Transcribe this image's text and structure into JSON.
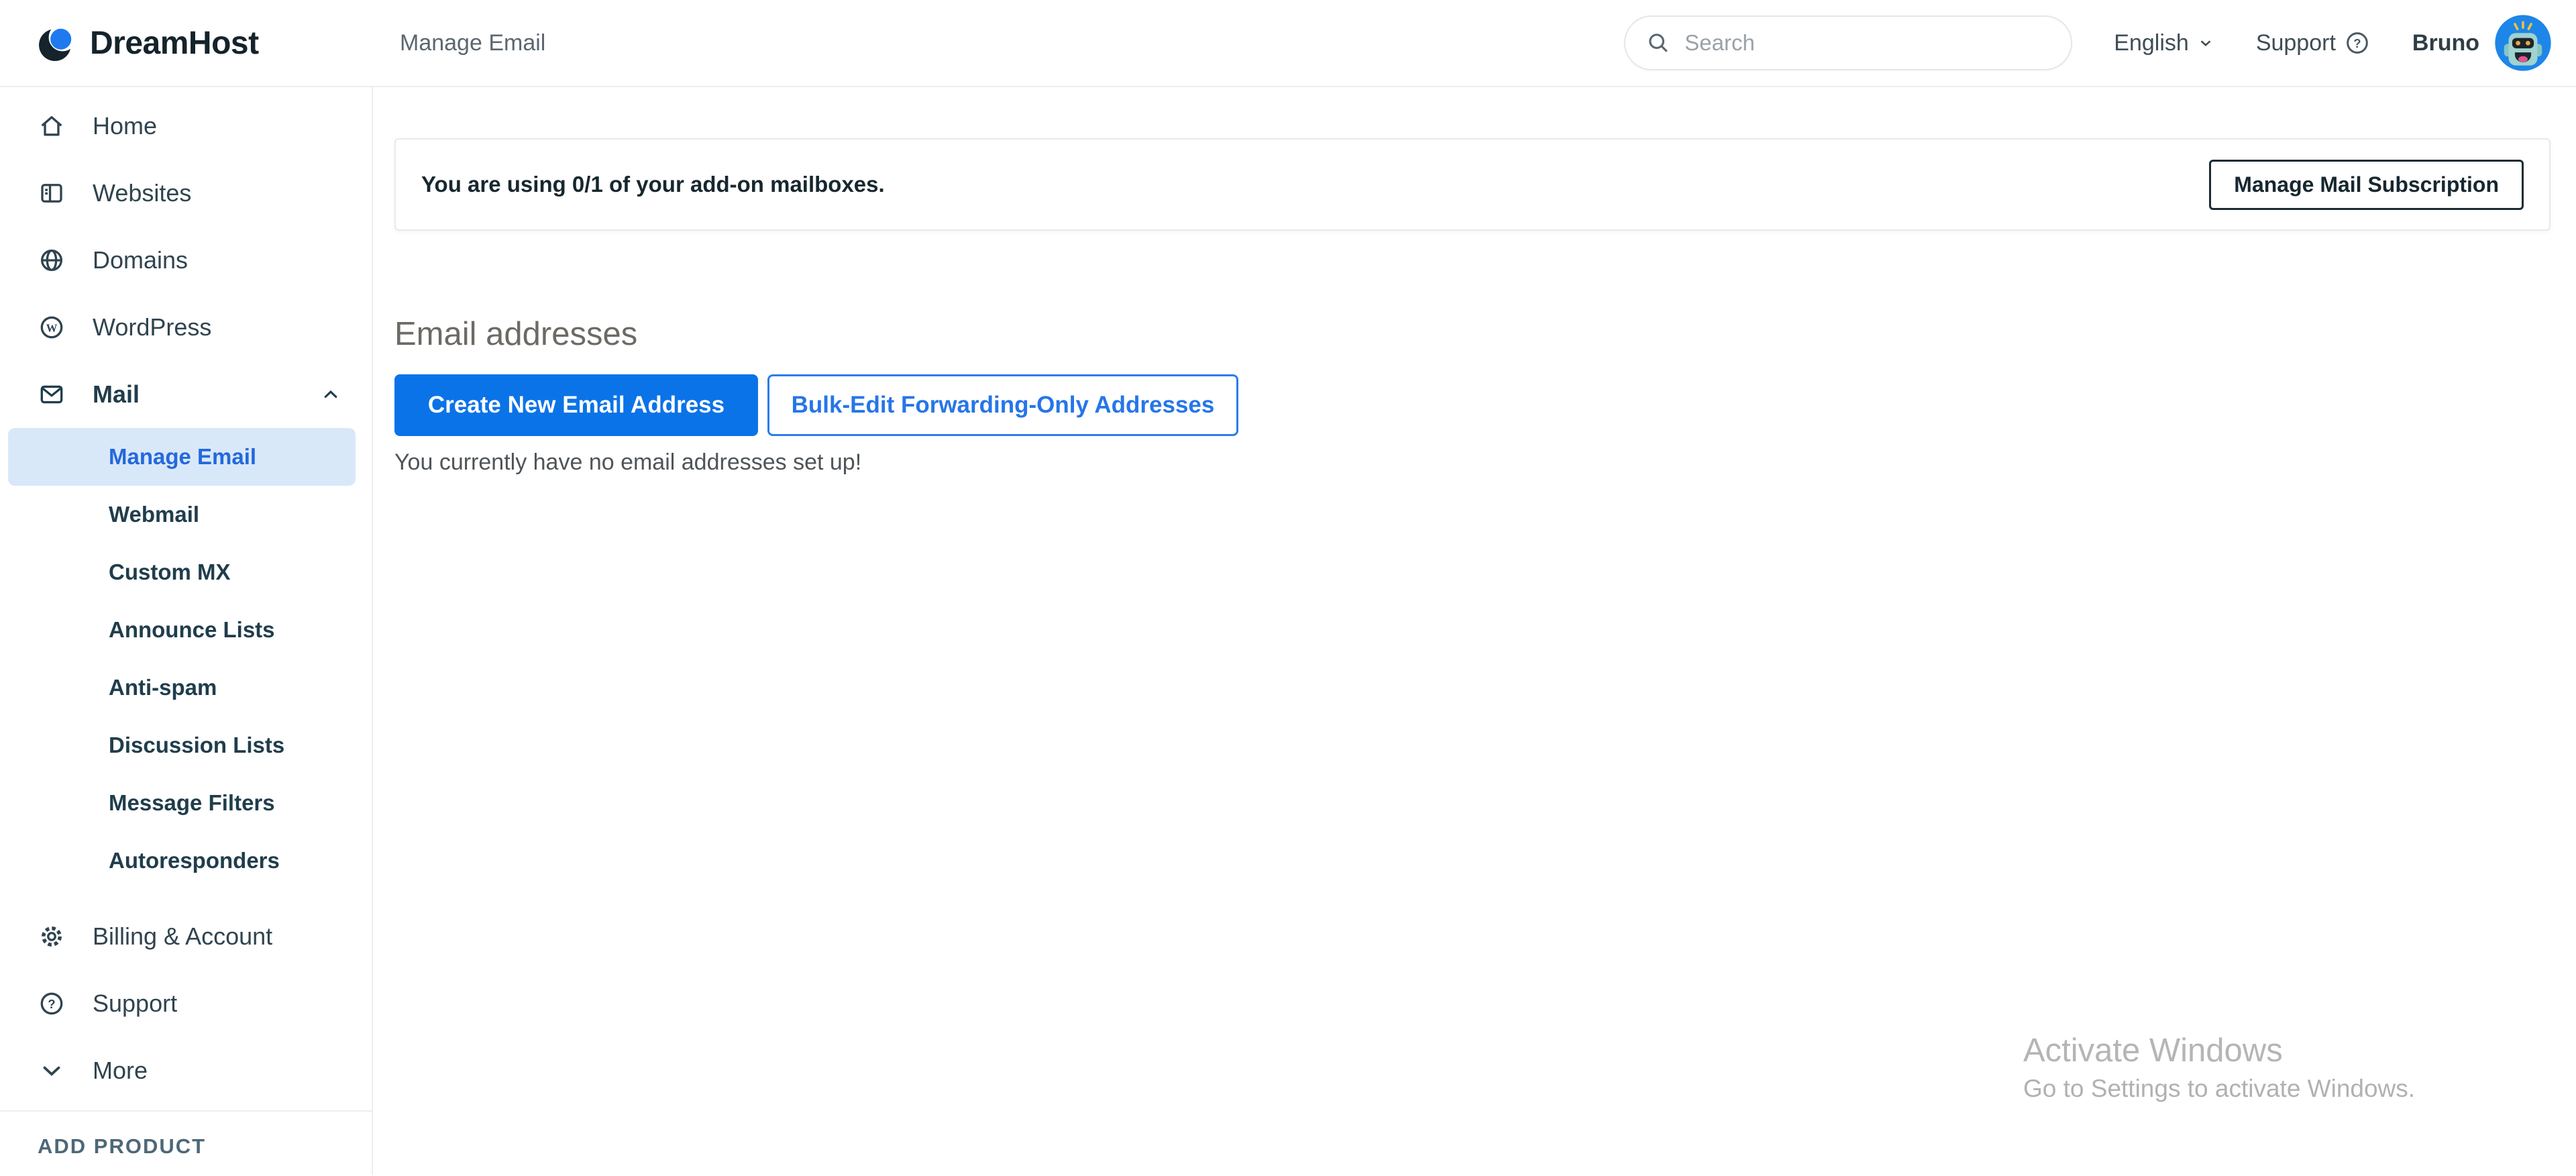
{
  "header": {
    "brand": "DreamHost",
    "page_title": "Manage Email",
    "search_placeholder": "Search",
    "language": "English",
    "support_label": "Support",
    "user_name": "Bruno"
  },
  "sidebar": {
    "items": [
      {
        "label": "Home",
        "icon": "home-icon"
      },
      {
        "label": "Websites",
        "icon": "browser-icon"
      },
      {
        "label": "Domains",
        "icon": "globe-icon"
      },
      {
        "label": "WordPress",
        "icon": "wordpress-icon"
      },
      {
        "label": "Mail",
        "icon": "envelope-icon",
        "expanded": true,
        "active_child": "Manage Email",
        "children": [
          "Manage Email",
          "Webmail",
          "Custom MX",
          "Announce Lists",
          "Anti-spam",
          "Discussion Lists",
          "Message Filters",
          "Autoresponders"
        ]
      },
      {
        "label": "Billing & Account",
        "icon": "gear-icon"
      },
      {
        "label": "Support",
        "icon": "question-circle-icon"
      },
      {
        "label": "More",
        "icon": "chevron-down-icon"
      }
    ],
    "add_product": "ADD PRODUCT"
  },
  "main": {
    "notice": {
      "text": "You are using 0/1 of your add-on mailboxes.",
      "button_label": "Manage Mail Subscription"
    },
    "section_title": "Email addresses",
    "buttons": {
      "create": "Create New Email Address",
      "bulk_edit": "Bulk-Edit Forwarding-Only Addresses"
    },
    "empty_message": "You currently have no email addresses set up!"
  },
  "watermark": {
    "line1": "Activate Windows",
    "line2": "Go to Settings to activate Windows."
  },
  "colors": {
    "accent_blue": "#0b73e8",
    "active_item_bg": "#d9e8f9",
    "active_item_text": "#2468dd",
    "sidebar_text": "#30444f",
    "border_gray": "#eceef0"
  }
}
